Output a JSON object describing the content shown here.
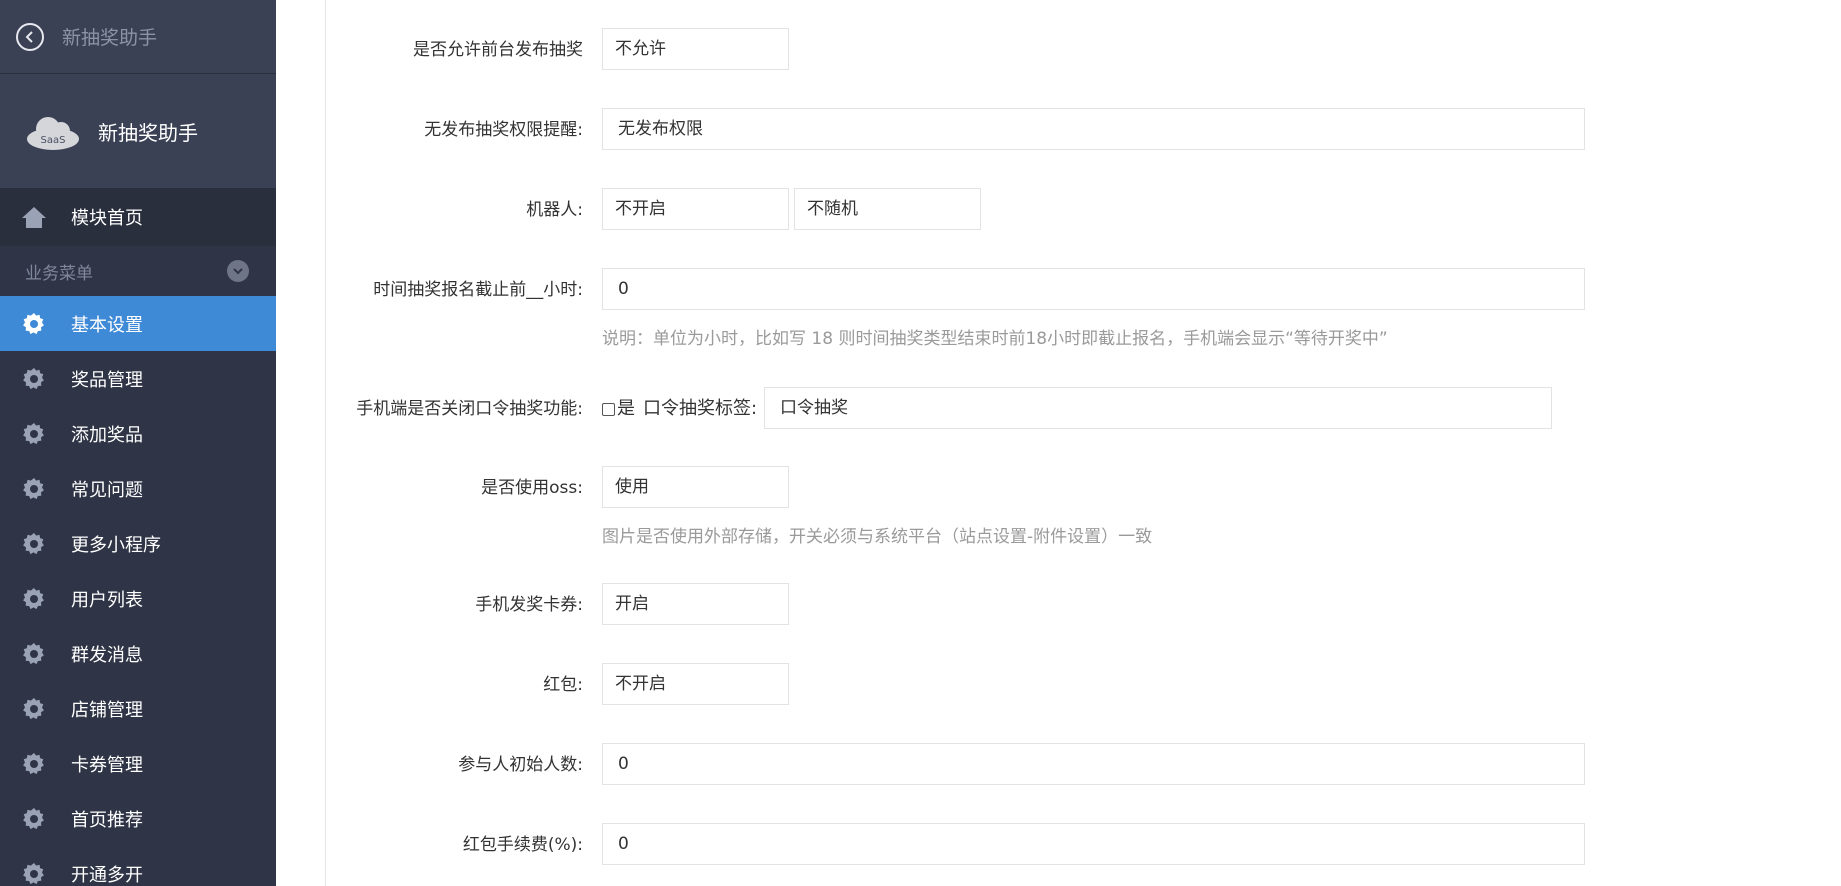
{
  "sidebar": {
    "top_title": "新抽奖助手",
    "brand_name": "新抽奖助手",
    "logo_text": "SaaS",
    "home_label": "模块首页",
    "section_label": "业务菜单",
    "items": [
      {
        "label": "基本设置",
        "active": true
      },
      {
        "label": "奖品管理"
      },
      {
        "label": "添加奖品"
      },
      {
        "label": "常见问题"
      },
      {
        "label": "更多小程序"
      },
      {
        "label": "用户列表"
      },
      {
        "label": "群发消息"
      },
      {
        "label": "店铺管理"
      },
      {
        "label": "卡券管理"
      },
      {
        "label": "首页推荐"
      },
      {
        "label": "开通多开"
      }
    ]
  },
  "form": {
    "allow_front_publish": {
      "label": "是否允许前台发布抽奖",
      "value": "不允许"
    },
    "no_permission_tip": {
      "label": "无发布抽奖权限提醒:",
      "value": "无发布权限"
    },
    "robot": {
      "label": "机器人:",
      "value": "不开启",
      "random_value": "不随机"
    },
    "deadline_hours": {
      "label": "时间抽奖报名截止前__小时:",
      "value": "0",
      "help": "说明：单位为小时，比如写 18 则时间抽奖类型结束时前18小时即截止报名，手机端会显示“等待开奖中”"
    },
    "close_password_lottery": {
      "label": "手机端是否关闭口令抽奖功能:",
      "checkbox_label": "是",
      "tag_label": "口令抽奖标签:",
      "tag_value": "口令抽奖"
    },
    "use_oss": {
      "label": "是否使用oss:",
      "value": "使用",
      "help": "图片是否使用外部存储，开关必须与系统平台（站点设置-附件设置）一致"
    },
    "mobile_coupon": {
      "label": "手机发奖卡券:",
      "value": "开启"
    },
    "red_packet": {
      "label": "红包:",
      "value": "不开启"
    },
    "initial_participants": {
      "label": "参与人初始人数:",
      "value": "0"
    },
    "red_packet_fee": {
      "label": "红包手续费(%):",
      "value": "0"
    }
  },
  "colors": {
    "sidebar_bg": "#2f3546",
    "sidebar_header_bg": "#3a4155",
    "active_item": "#3f8ad6",
    "help_text": "#9a9a9a"
  }
}
